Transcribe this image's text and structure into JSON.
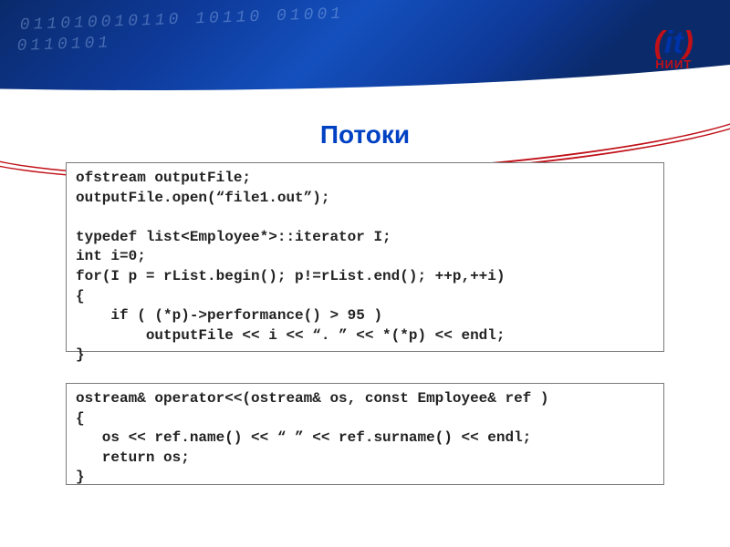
{
  "logo": {
    "mark_prefix": "(",
    "mark_text": "it",
    "mark_suffix": ")",
    "subtitle": "НИИТ"
  },
  "title": "Потоки",
  "code1": "ofstream outputFile;\noutputFile.open(“file1.out”);\n\ntypedef list<Employee*>::iterator I;\nint i=0;\nfor(I p = rList.begin(); p!=rList.end(); ++p,++i)\n{\n    if ( (*p)->performance() > 95 )\n        outputFile << i << “. ” << *(*p) << endl;\n}",
  "code2": "ostream& operator<<(ostream& os, const Employee& ref )\n{\n   os << ref.name() << “ ” << ref.surname() << endl;\n   return os;\n}"
}
